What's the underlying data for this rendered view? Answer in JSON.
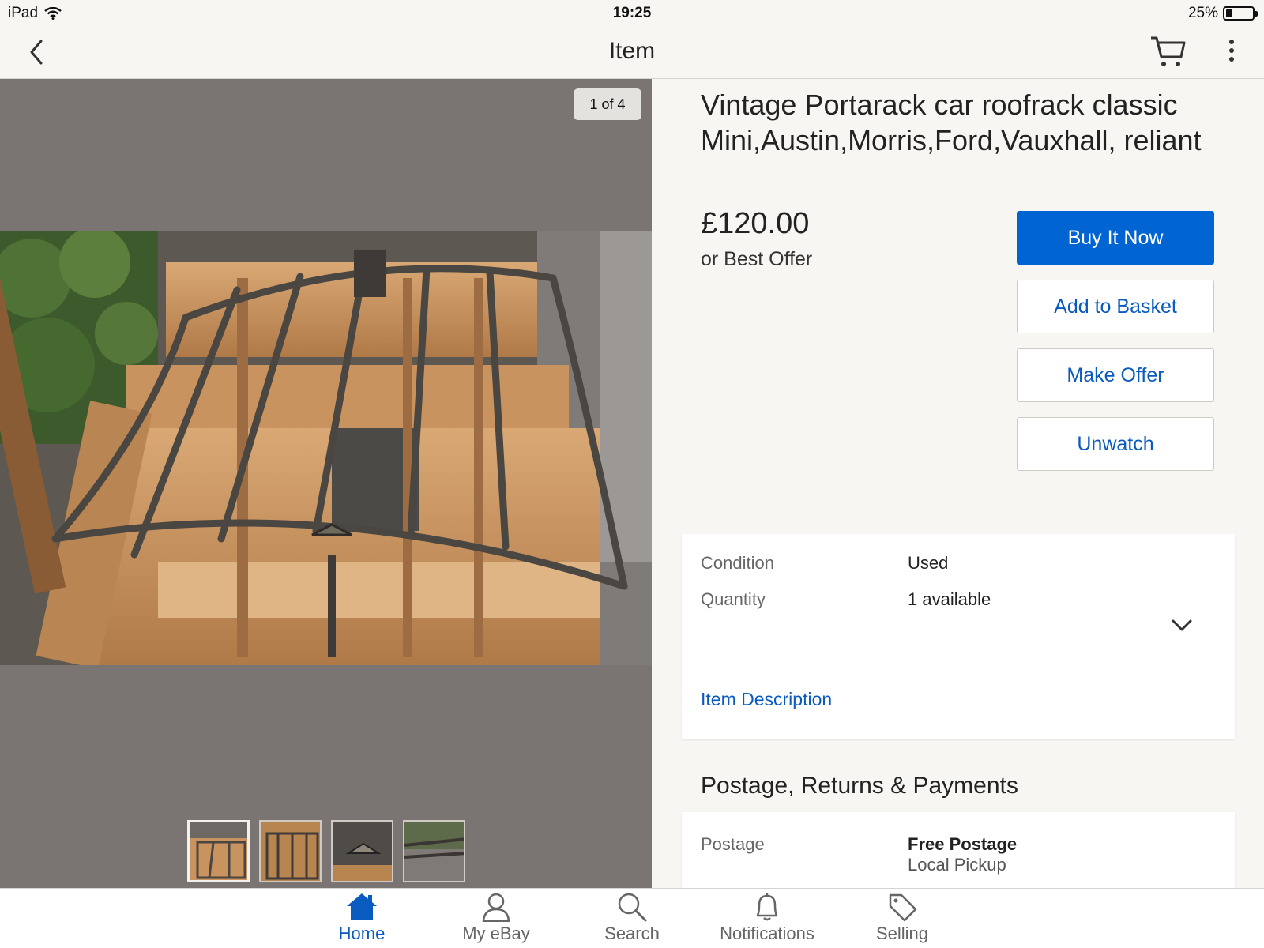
{
  "status_bar": {
    "device": "iPad",
    "time": "19:25",
    "battery": "25%",
    "battery_level": 0.25
  },
  "nav": {
    "title": "Item",
    "back_icon": "chevron-left-icon",
    "cart_icon": "cart-icon",
    "more_icon": "more-vertical-icon"
  },
  "gallery": {
    "counter": "1 of 4",
    "current_index": 1,
    "total": 4
  },
  "item": {
    "title": "Vintage Portarack car roofrack classic Mini,Austin,Morris,Ford,Vauxhall, reliant",
    "price": "£120.00",
    "best_offer": "or Best Offer"
  },
  "actions": {
    "buy_now": "Buy It Now",
    "add_to_basket": "Add to Basket",
    "make_offer": "Make Offer",
    "unwatch": "Unwatch"
  },
  "specs": {
    "condition_label": "Condition",
    "condition_value": "Used",
    "quantity_label": "Quantity",
    "quantity_value": "1 available",
    "item_description": "Item Description"
  },
  "postage_section": {
    "heading": "Postage, Returns & Payments",
    "postage_label": "Postage",
    "postage_free": "Free Postage",
    "postage_pickup": "Local Pickup"
  },
  "tabs": [
    {
      "label": "Home",
      "icon": "home-icon",
      "active": true
    },
    {
      "label": "My eBay",
      "icon": "user-icon",
      "active": false
    },
    {
      "label": "Search",
      "icon": "search-icon",
      "active": false
    },
    {
      "label": "Notifications",
      "icon": "bell-icon",
      "active": false
    },
    {
      "label": "Selling",
      "icon": "tag-icon",
      "active": false
    }
  ],
  "colors": {
    "accent": "#0064d2",
    "link": "#0a5bbf",
    "gallery_bg": "#7a7572"
  }
}
